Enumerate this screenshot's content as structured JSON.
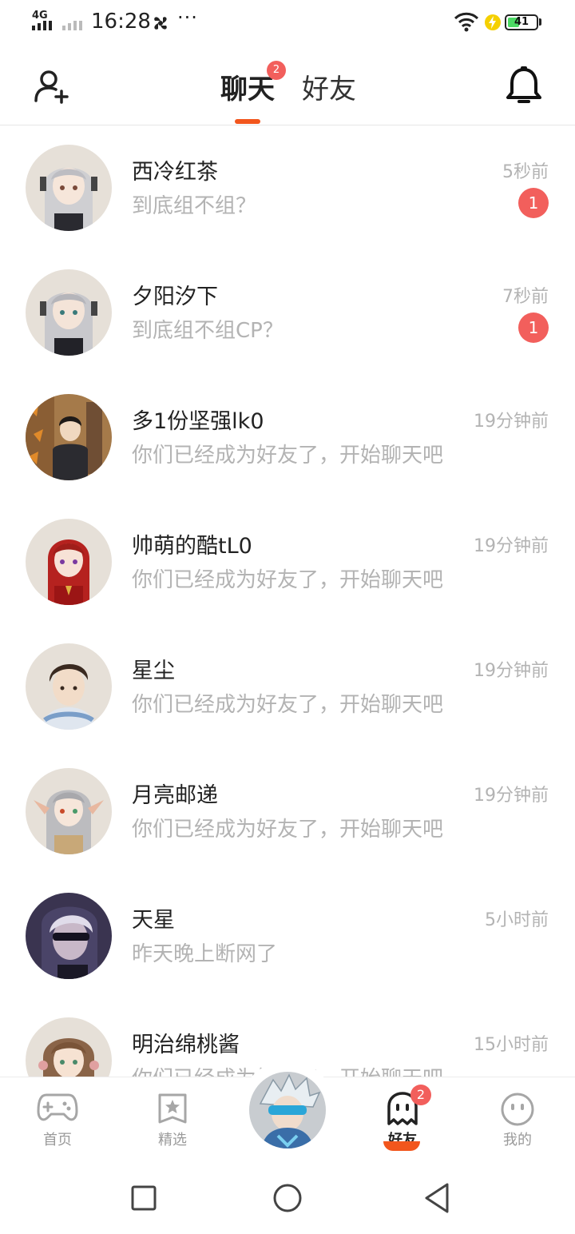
{
  "status_bar": {
    "network": "4G",
    "time": "16:28",
    "more": "···",
    "battery": "41",
    "battery_level": 0.41
  },
  "header": {
    "tabs": [
      {
        "label": "聊天",
        "badge": "2",
        "active": true
      },
      {
        "label": "好友",
        "active": false
      }
    ]
  },
  "chats": [
    {
      "name": "西冷红茶",
      "message": "到底组不组？",
      "time": "5秒前",
      "unread": "1"
    },
    {
      "name": "夕阳汐下",
      "message": "到底组不组CP？",
      "time": "7秒前",
      "unread": "1"
    },
    {
      "name": "多1份坚强lk0",
      "message": "你们已经成为好友了，开始聊天吧",
      "time": "19分钟前"
    },
    {
      "name": "帅萌的酷tL0",
      "message": "你们已经成为好友了，开始聊天吧",
      "time": "19分钟前"
    },
    {
      "name": "星尘",
      "message": "你们已经成为好友了，开始聊天吧",
      "time": "19分钟前"
    },
    {
      "name": "月亮邮递",
      "message": "你们已经成为好友了，开始聊天吧",
      "time": "19分钟前"
    },
    {
      "name": "天星",
      "message": "昨天晚上断网了",
      "time": "5小时前"
    },
    {
      "name": "明治绵桃酱",
      "message": "你们已经成为好友了，开始聊天吧",
      "time": "15小时前"
    }
  ],
  "bottom_nav": {
    "items": [
      {
        "label": "首页",
        "icon": "gamepad-icon"
      },
      {
        "label": "精选",
        "icon": "star-icon"
      },
      {
        "label": "好友",
        "icon": "ghost-icon",
        "badge": "2",
        "active": true
      },
      {
        "label": "我的",
        "icon": "smiley-icon"
      }
    ]
  },
  "colors": {
    "accent": "#f2561d",
    "badge": "#f25f5c",
    "muted_text": "#b3b3b3"
  }
}
